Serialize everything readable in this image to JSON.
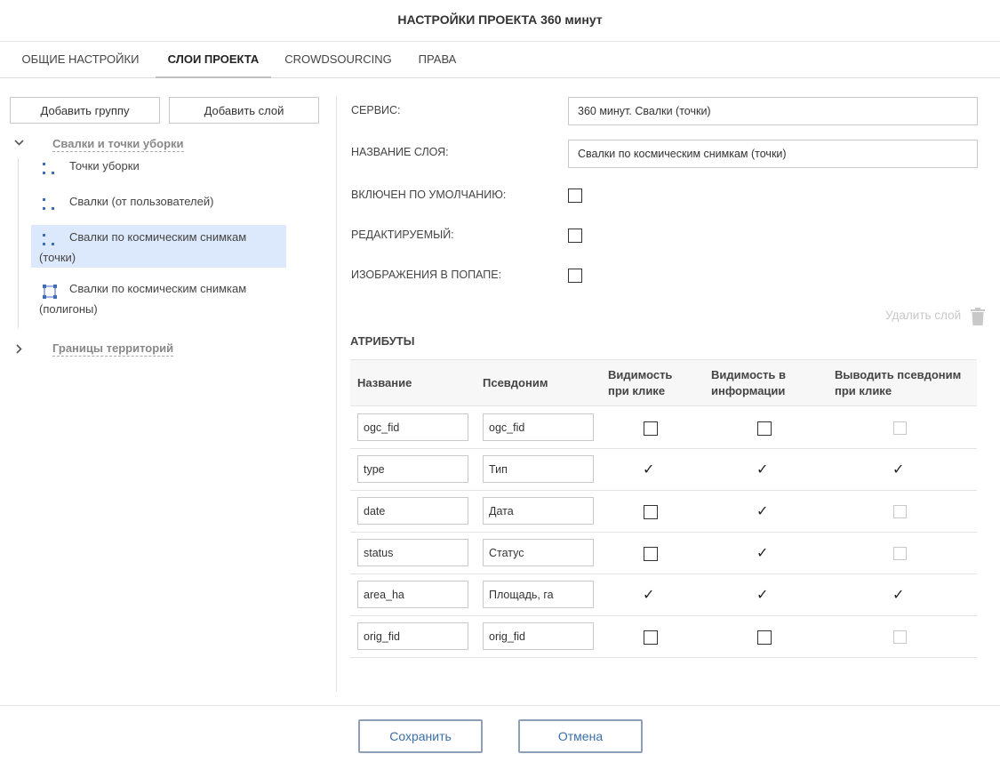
{
  "title": "НАСТРОЙКИ ПРОЕКТА 360 минут",
  "tabs": [
    "ОБЩИЕ НАСТРОЙКИ",
    "СЛОИ ПРОЕКТА",
    "CROWDSOURCING",
    "ПРАВА"
  ],
  "active_tab": "СЛОИ ПРОЕКТА",
  "left": {
    "add_group": "Добавить группу",
    "add_layer": "Добавить слой",
    "groups": [
      {
        "label": "Свалки и точки уборки",
        "expanded": true,
        "layers": [
          {
            "line1": "Точки уборки",
            "line2": "",
            "icon": "point-layer-icon"
          },
          {
            "line1": "Свалки (от пользователей)",
            "line2": "",
            "icon": "point-layer-icon"
          },
          {
            "line1": "Свалки по космическим снимкам",
            "line2": "(точки)",
            "icon": "point-layer-icon",
            "selected": true
          },
          {
            "line1": "Свалки по космическим снимкам",
            "line2": "(полигоны)",
            "icon": "polygon-layer-icon"
          }
        ]
      },
      {
        "label": "Границы территорий",
        "expanded": false
      }
    ]
  },
  "form": {
    "service_label": "СЕРВИС:",
    "service_value": "360 минут. Свалки (точки)",
    "name_label": "НАЗВАНИЕ СЛОЯ:",
    "name_value": "Свалки по космическим снимкам (точки)",
    "default_on_label": "ВКЛЮЧЕН ПО УМОЛЧАНИЮ:",
    "editable_label": "РЕДАКТИРУЕМЫЙ:",
    "popup_images_label": "ИЗОБРАЖЕНИЯ В ПОПАПЕ:",
    "delete_layer": "Удалить слой"
  },
  "attributes": {
    "title": "АТРИБУТЫ",
    "headers": {
      "name": "Название",
      "alias": "Псевдоним",
      "click_vis_1": "Видимость",
      "click_vis_2": "при клике",
      "info_vis_1": "Видимость в",
      "info_vis_2": "информации",
      "alias_click_1": "Выводить псевдоним",
      "alias_click_2": "при клике"
    },
    "rows": [
      {
        "name": "ogc_fid",
        "alias": "ogc_fid",
        "click": false,
        "info": false,
        "alias_click": false
      },
      {
        "name": "type",
        "alias": "Тип",
        "click": true,
        "info": true,
        "alias_click": true
      },
      {
        "name": "date",
        "alias": "Дата",
        "click": false,
        "info": true,
        "alias_click": false
      },
      {
        "name": "status",
        "alias": "Статус",
        "click": false,
        "info": true,
        "alias_click": false
      },
      {
        "name": "area_ha",
        "alias": "Площадь, га",
        "click": true,
        "info": true,
        "alias_click": true
      },
      {
        "name": "orig_fid",
        "alias": "orig_fid",
        "click": false,
        "info": false,
        "alias_click": false
      }
    ]
  },
  "footer": {
    "save": "Сохранить",
    "cancel": "Отмена"
  },
  "colors": {
    "accent": "#3a6fa8",
    "selected_bg": "#dce8fb",
    "icon": "#3f6eb5"
  }
}
